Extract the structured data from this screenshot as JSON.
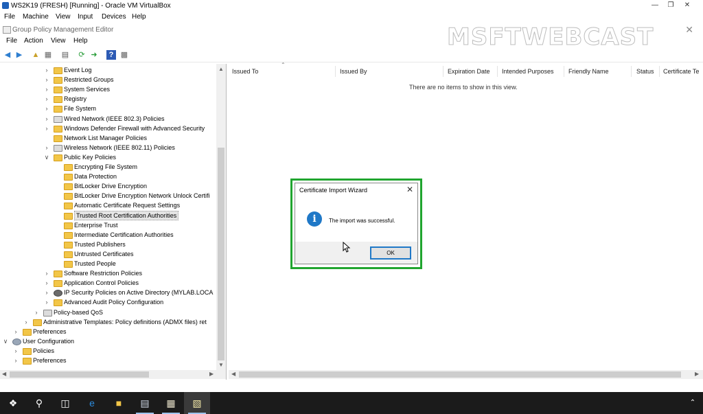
{
  "vbox": {
    "title": "WS2K19 (FRESH) [Running] - Oracle VM VirtualBox",
    "menu": [
      "File",
      "Machine",
      "View",
      "Input",
      "Devices",
      "Help"
    ]
  },
  "gpme": {
    "title": "Group Policy Management Editor",
    "watermark": "MSFTWEBCAST",
    "menu": [
      "File",
      "Action",
      "View",
      "Help"
    ]
  },
  "tree": {
    "items": [
      {
        "label": "Event Log",
        "level": 3,
        "expander": ">",
        "icon": "folder-lock-icon"
      },
      {
        "label": "Restricted Groups",
        "level": 3,
        "expander": ">",
        "icon": "folder-lock-icon"
      },
      {
        "label": "System Services",
        "level": 3,
        "expander": ">",
        "icon": "folder-lock-icon"
      },
      {
        "label": "Registry",
        "level": 3,
        "expander": ">",
        "icon": "folder-lock-icon"
      },
      {
        "label": "File System",
        "level": 3,
        "expander": ">",
        "icon": "folder-lock-icon"
      },
      {
        "label": "Wired Network (IEEE 802.3) Policies",
        "level": 3,
        "expander": ">",
        "icon": "network-policy-icon"
      },
      {
        "label": "Windows Defender Firewall with Advanced Security",
        "level": 3,
        "expander": ">",
        "icon": "folder-icon"
      },
      {
        "label": "Network List Manager Policies",
        "level": 3,
        "expander": "",
        "icon": "folder-icon"
      },
      {
        "label": "Wireless Network (IEEE 802.11) Policies",
        "level": 3,
        "expander": ">",
        "icon": "network-policy-icon"
      },
      {
        "label": "Public Key Policies",
        "level": 3,
        "expander": "v",
        "icon": "folder-icon"
      },
      {
        "label": "Encrypting File System",
        "level": 4,
        "expander": "",
        "icon": "folder-icon"
      },
      {
        "label": "Data Protection",
        "level": 4,
        "expander": "",
        "icon": "folder-icon"
      },
      {
        "label": "BitLocker Drive Encryption",
        "level": 4,
        "expander": "",
        "icon": "folder-icon"
      },
      {
        "label": "BitLocker Drive Encryption Network Unlock Certifi",
        "level": 4,
        "expander": "",
        "icon": "folder-icon"
      },
      {
        "label": "Automatic Certificate Request Settings",
        "level": 4,
        "expander": "",
        "icon": "folder-icon"
      },
      {
        "label": "Trusted Root Certification Authorities",
        "level": 4,
        "expander": "",
        "icon": "folder-icon",
        "selected": true
      },
      {
        "label": "Enterprise Trust",
        "level": 4,
        "expander": "",
        "icon": "folder-icon"
      },
      {
        "label": "Intermediate Certification Authorities",
        "level": 4,
        "expander": "",
        "icon": "folder-icon"
      },
      {
        "label": "Trusted Publishers",
        "level": 4,
        "expander": "",
        "icon": "folder-icon"
      },
      {
        "label": "Untrusted Certificates",
        "level": 4,
        "expander": "",
        "icon": "folder-icon"
      },
      {
        "label": "Trusted People",
        "level": 4,
        "expander": "",
        "icon": "folder-icon"
      },
      {
        "label": "Software Restriction Policies",
        "level": 3,
        "expander": ">",
        "icon": "folder-icon"
      },
      {
        "label": "Application Control Policies",
        "level": 3,
        "expander": ">",
        "icon": "folder-icon"
      },
      {
        "label": "IP Security Policies on Active Directory (MYLAB.LOCA",
        "level": 3,
        "expander": ">",
        "icon": "ipsec-icon"
      },
      {
        "label": "Advanced Audit Policy Configuration",
        "level": 3,
        "expander": ">",
        "icon": "folder-icon"
      },
      {
        "label": "Policy-based QoS",
        "level": 2,
        "expander": ">",
        "icon": "qos-chart-icon"
      },
      {
        "label": "Administrative Templates: Policy definitions (ADMX files) ret",
        "level": 1,
        "expander": ">",
        "icon": "folder-icon"
      },
      {
        "label": "Preferences",
        "level": 0,
        "expander": ">",
        "icon": "folder-icon"
      },
      {
        "label": "User Configuration",
        "level": -1,
        "expander": "v",
        "icon": "user-config-icon"
      },
      {
        "label": "Policies",
        "level": 0,
        "expander": ">",
        "icon": "folder-icon"
      },
      {
        "label": "Preferences",
        "level": 0,
        "expander": ">",
        "icon": "folder-icon"
      }
    ]
  },
  "list": {
    "columns": [
      "Issued To",
      "Issued By",
      "Expiration Date",
      "Intended Purposes",
      "Friendly Name",
      "Status",
      "Certificate Te"
    ],
    "empty_message": "There are no items to show in this view."
  },
  "dialog": {
    "title": "Certificate Import Wizard",
    "message": "The import was successful.",
    "ok_label": "OK",
    "close_glyph": "✕",
    "info_glyph": "i",
    "highlight_color": "#20a52f"
  },
  "colors": {
    "accent": "#1f78c7",
    "folder": "#f2c648",
    "taskbar": "#1b1b1b"
  }
}
